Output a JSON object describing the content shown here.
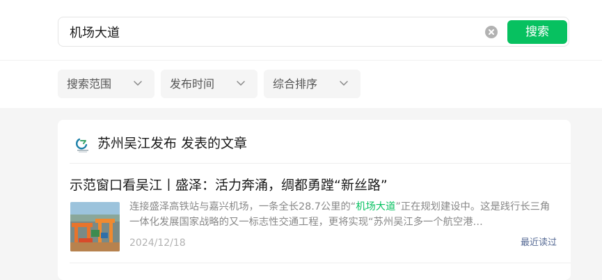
{
  "search": {
    "query": "机场大道",
    "button_label": "搜索"
  },
  "filters": [
    {
      "label": "搜索范围"
    },
    {
      "label": "发布时间"
    },
    {
      "label": "综合排序"
    }
  ],
  "account": {
    "title": "苏州吴江发布 发表的文章"
  },
  "article": {
    "title": "示范窗口看吴江丨盛泽：活力奔涌，绸都勇蹚“新丝路”",
    "snippet_before": "连接盛泽高铁站与嘉兴机场，一条全长28.7公里的“",
    "snippet_highlight": "机场大道",
    "snippet_after": "”正在规划建设中。这是践行长三角一体化发展国家战略的又一标志性交通工程，更将实现“苏州吴江多一个航空港…",
    "date": "2024/12/18",
    "tag": "最近读过"
  },
  "colors": {
    "accent": "#07c160",
    "tag": "#576b95",
    "muted_text": "#888888",
    "page_background": "#f5f5f5"
  },
  "icons": {
    "clear": "clear-circle-icon",
    "chevron": "chevron-down-icon",
    "account_logo": "wujiang-logo-icon"
  }
}
